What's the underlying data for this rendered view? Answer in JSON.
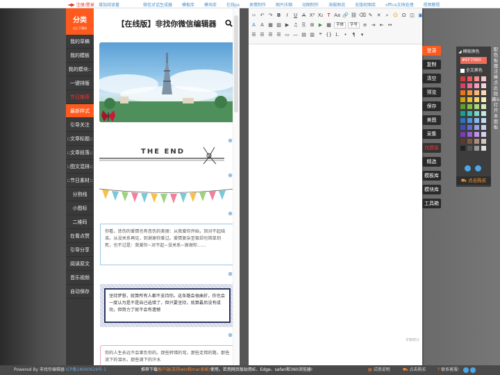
{
  "topbar": {
    "login": "注册/登录",
    "add": "增加阅读量",
    "links": [
      "微信对话生成器",
      "模板库",
      "模块库",
      "在线ps",
      "表情制作",
      "图片压缩",
      "动图制作",
      "海报图说",
      "无版权图库",
      "office文档处理",
      "视频教程"
    ]
  },
  "sidebar": {
    "title": "分类",
    "subtitle": "点上下滚动",
    "items": [
      "我的草稿",
      "我的模板",
      "我的模块::",
      "一键排版",
      "节日推荐",
      "最新样式",
      "引导关注",
      "::文章标题::",
      "::文章段落::",
      "::图文混排::",
      "::节日素材::",
      "分割线",
      "小图标",
      "二维码",
      "在看点赞",
      "引导分享",
      "阅读原文",
      "音乐视频",
      "自动保存"
    ]
  },
  "template": {
    "title": "【在线版】非找你微信编辑器",
    "the_end": "THE END",
    "card1": "你看，悲伤的爱情也有悲伤的美丽：从我爱你开始，到对不起结束。从没关系再见，到谢谢你爱过。爱情复杂至极却也简单到死，也不过是：我爱你~对不起~没关系~谢谢你……",
    "card2": "坚持梦想，就算所有人都不支持你。这条路会很曲折，你也会一度认为是不是自己选错了，但只要坚持，就算最后没有成功，但努力了就不会有遗憾",
    "card3": "你的人生永远不会辜负你的。那些转错的弯，那些走错的路，那些流下的泪水，那些滴下的汗水"
  },
  "editor": {
    "font_family": "字体",
    "font_size": "字号",
    "counter": "字数统计"
  },
  "actions": [
    "登录",
    "复制",
    "清空",
    "预览",
    "保存",
    "美图",
    "采集",
    "找模板",
    "精选",
    "模板库",
    "模块库",
    "工具箱"
  ],
  "color_panel": {
    "header": "模板换色",
    "hex": "#EF7060",
    "full_label": "全文换色",
    "buy": "点击购买",
    "side_text": "配色板 魔法棒 点此隐藏&打开本面板",
    "swatches": [
      "#d63a3a",
      "#e85a5a",
      "#ef8f8f",
      "#f6c7c7",
      "#d63f6e",
      "#ec6f97",
      "#f2a0bd",
      "#f9d0de",
      "#e8741c",
      "#f0973f",
      "#f7b77a",
      "#fbd9b7",
      "#d8a300",
      "#eec12c",
      "#f5d76a",
      "#faecb4",
      "#5ba12a",
      "#84c048",
      "#a9d67a",
      "#d3ebbc",
      "#1a9e8e",
      "#3cbcac",
      "#7dd4c8",
      "#bde9e3",
      "#2a74c4",
      "#4d95df",
      "#86b8ec",
      "#c2dcf6",
      "#3a4fb8",
      "#5b6fd3",
      "#94a1e3",
      "#cad0f1",
      "#7a3cb8",
      "#9a5fd3",
      "#bd95e3",
      "#ddcaf1",
      "#5a3a2a",
      "#7e5a46",
      "#a98e7f",
      "#d4c6bf",
      "#222222",
      "#555555",
      "#999999",
      "#dddddd"
    ]
  },
  "footer": {
    "powered": "Powered By 非找你编辑器",
    "icp": "ICP备18060628号-1",
    "notice_a": "推荐下载",
    "notice_b": "客户端(支持win和mac系统)",
    "notice_c": "使用，若用网页版幼用IE、Edge、safari和360浏览器!",
    "help": "试用说明",
    "buy": "点击购买",
    "contact": "联系客服："
  }
}
